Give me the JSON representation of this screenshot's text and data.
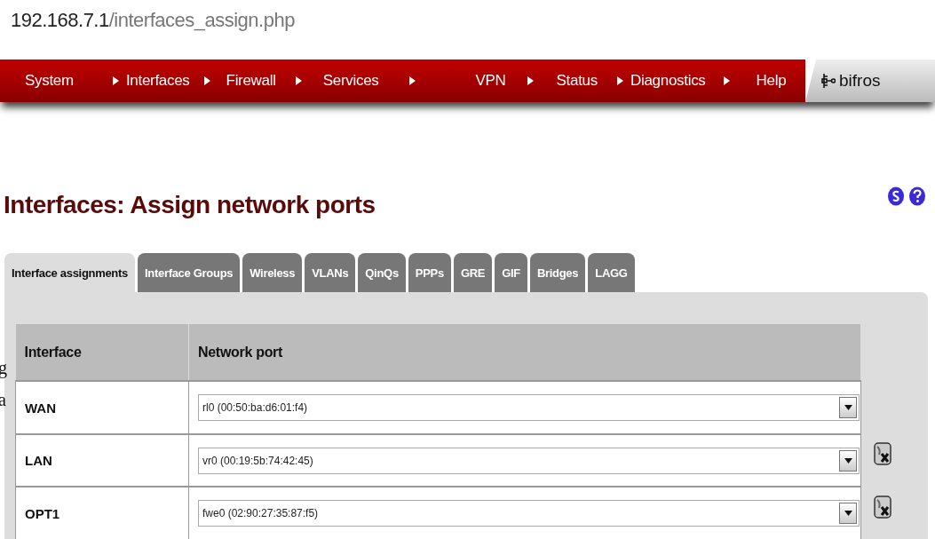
{
  "address_bar": {
    "host": "192.168.7.1",
    "path": "/interfaces_assign.php"
  },
  "nav": {
    "items": [
      {
        "label": "System",
        "arrow": false
      },
      {
        "label": "Interfaces",
        "arrow": true
      },
      {
        "label": "Firewall",
        "arrow": true
      },
      {
        "label": "Services",
        "arrow": true
      },
      {
        "label": "VPN",
        "arrow": true
      },
      {
        "label": "Status",
        "arrow": true
      },
      {
        "label": "Diagnostics",
        "arrow": true
      },
      {
        "label": "Help",
        "arrow": true
      }
    ],
    "hostname": "bifros"
  },
  "page_title": "Interfaces: Assign network ports",
  "tabs": [
    {
      "label": "Interface assignments",
      "selected": true
    },
    {
      "label": "Interface Groups",
      "selected": false
    },
    {
      "label": "Wireless",
      "selected": false
    },
    {
      "label": "VLANs",
      "selected": false
    },
    {
      "label": "QinQs",
      "selected": false
    },
    {
      "label": "PPPs",
      "selected": false
    },
    {
      "label": "GRE",
      "selected": false
    },
    {
      "label": "GIF",
      "selected": false
    },
    {
      "label": "Bridges",
      "selected": false
    },
    {
      "label": "LAGG",
      "selected": false
    }
  ],
  "table": {
    "columns": [
      "Interface",
      "Network port"
    ],
    "rows": [
      {
        "interface": "WAN",
        "port": "rl0 (00:50:ba:d6:01:f4)",
        "deletable": false
      },
      {
        "interface": "LAN",
        "port": "vr0 (00:19:5b:74:42:45)",
        "deletable": true
      },
      {
        "interface": "OPT1",
        "port": "fwe0 (02:90:27:35:87:f5)",
        "deletable": true
      }
    ]
  },
  "background_fragments": [
    "g",
    "a"
  ]
}
